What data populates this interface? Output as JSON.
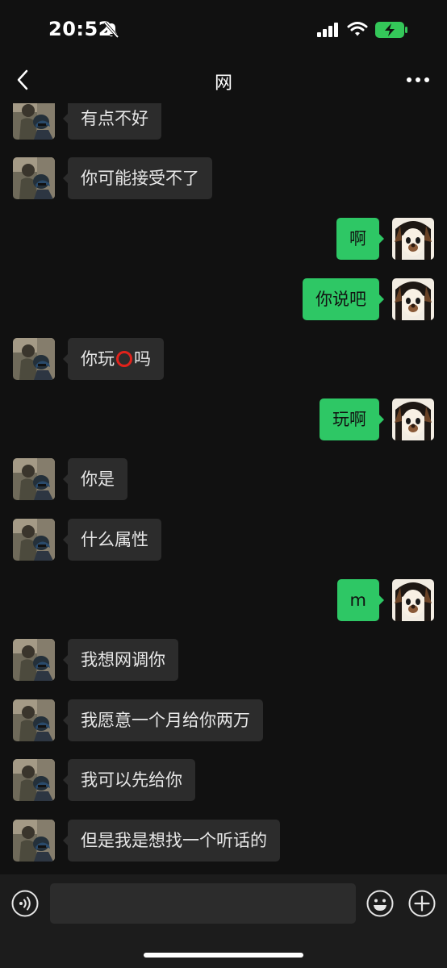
{
  "status_bar": {
    "time": "20:52",
    "icons": [
      "bell-slash-icon",
      "signal-icon",
      "wifi-icon",
      "battery-charging-icon"
    ],
    "battery_color": "#34c759"
  },
  "nav": {
    "title": "网",
    "back_icon": "chevron-left-icon",
    "more_icon": "more-dots-icon"
  },
  "colors": {
    "background": "#111111",
    "incoming_bubble": "#2c2c2c",
    "outgoing_bubble": "#2ec765",
    "input_bar": "#1c1c1c"
  },
  "messages": [
    {
      "side": "left",
      "text": "有点不好"
    },
    {
      "side": "left",
      "text": "你可能接受不了"
    },
    {
      "side": "right",
      "text": "啊"
    },
    {
      "side": "right",
      "text": "你说吧"
    },
    {
      "side": "left",
      "text_before": "你玩",
      "emoji": "red-circle-emoji",
      "text_after": "吗"
    },
    {
      "side": "right",
      "text": "玩啊"
    },
    {
      "side": "left",
      "text": "你是"
    },
    {
      "side": "left",
      "text": "什么属性"
    },
    {
      "side": "right",
      "text": "m"
    },
    {
      "side": "left",
      "text": "我想网调你"
    },
    {
      "side": "left",
      "text": "我愿意一个月给你两万"
    },
    {
      "side": "left",
      "text": "我可以先给你"
    },
    {
      "side": "left",
      "text": "但是我是想找一个听话的"
    }
  ],
  "input_bar": {
    "placeholder": "",
    "value": "",
    "voice_icon": "voice-icon",
    "emoji_icon": "emoji-smile-icon",
    "plus_icon": "plus-circle-icon"
  }
}
